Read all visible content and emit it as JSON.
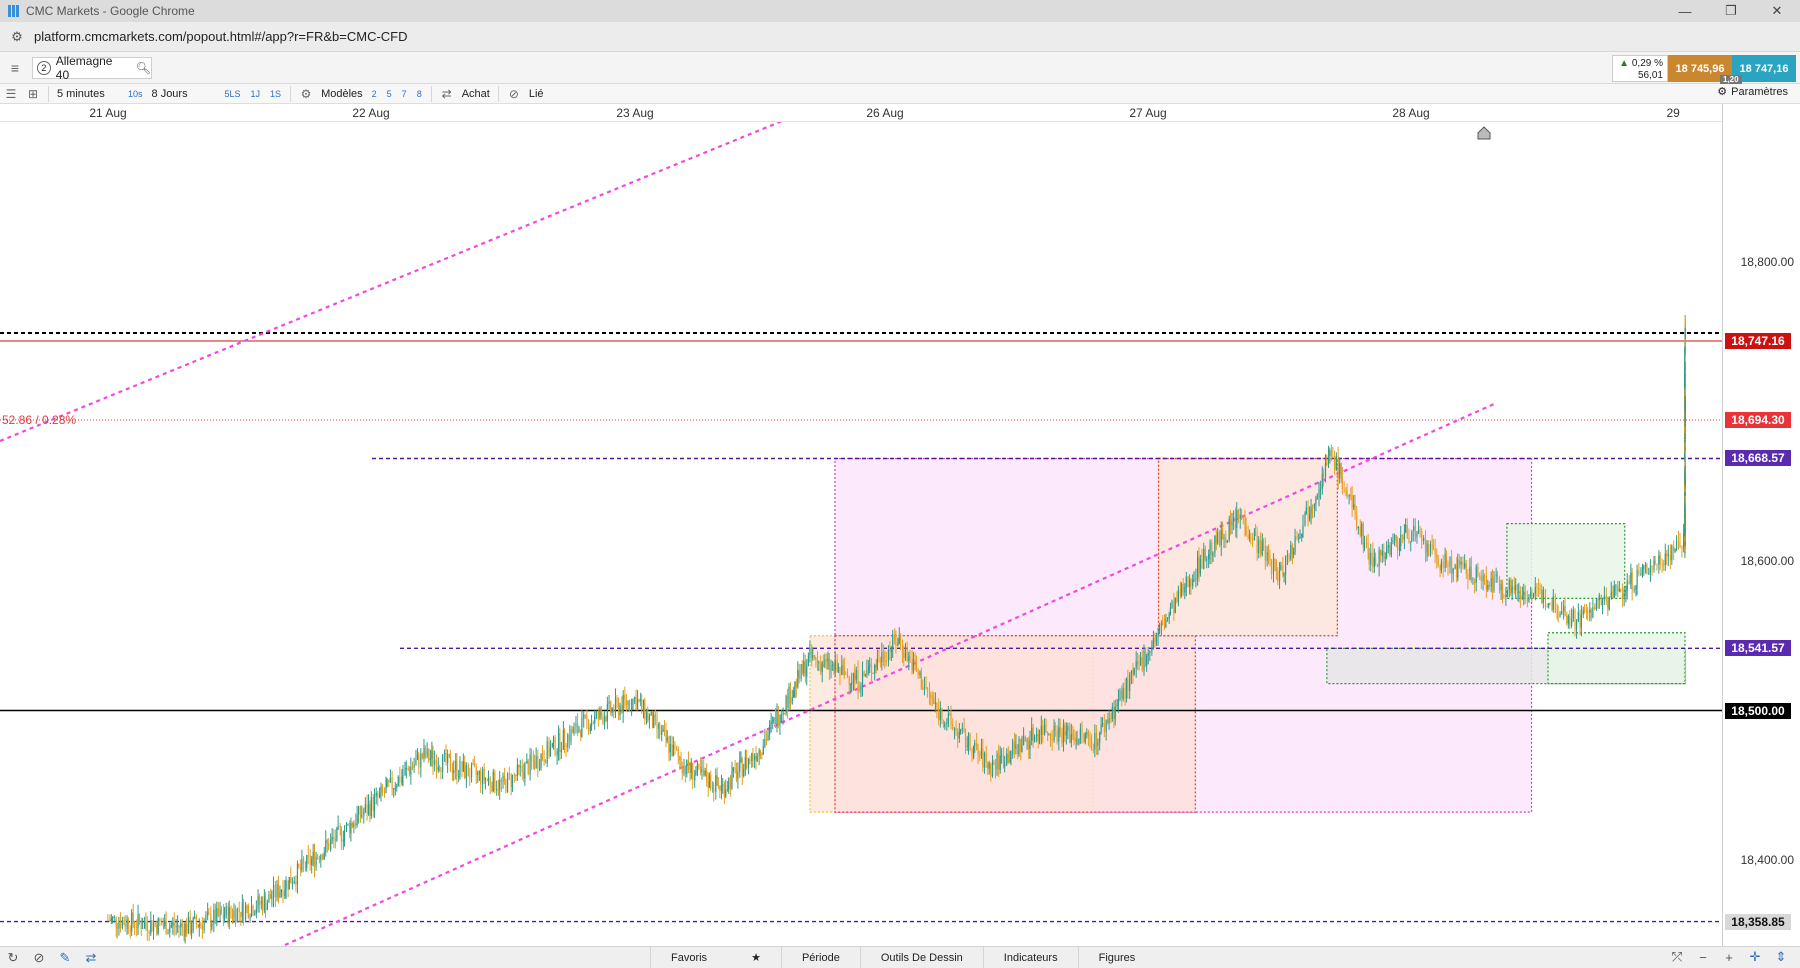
{
  "browser": {
    "window_title": "CMC Markets - Google Chrome",
    "url": "platform.cmcmarkets.com/popout.html#/app?r=FR&b=CMC-CFD",
    "win_buttons": [
      "—",
      "❐",
      "✕"
    ]
  },
  "instrument": {
    "number": "2",
    "name": "Allemagne 40",
    "change_pct": "0,29 %",
    "change_abs": "56,01",
    "sell_price": "18 745,96",
    "buy_price": "18 747,16",
    "spread": "1,20"
  },
  "toolbar": {
    "interval": "5 minutes",
    "interval_short": "10s",
    "range": "8 Jours",
    "range_buttons": [
      "5LS",
      "1J",
      "1S"
    ],
    "models_label": "Modèles",
    "model_buttons": [
      "2",
      "5",
      "7",
      "8"
    ],
    "buy_label": "Achat",
    "linked_label": "Lié",
    "settings_label": "Paramètres"
  },
  "date_axis": [
    "21 Aug",
    "22 Aug",
    "23 Aug",
    "26 Aug",
    "27 Aug",
    "28 Aug",
    "29 Aug"
  ],
  "price_axis": {
    "ticks": [
      "18,800.00",
      "18,600.00",
      "18,400.00"
    ],
    "tags": [
      {
        "label": "18,747.16",
        "value": 18747.16,
        "bg": "#cc1111",
        "fg": "#ffffff"
      },
      {
        "label": "18,694.30",
        "value": 18694.3,
        "bg": "#e8333a",
        "fg": "#ffffff"
      },
      {
        "label": "18,668.57",
        "value": 18668.57,
        "bg": "#5a2bb0",
        "fg": "#ffffff"
      },
      {
        "label": "18,541.57",
        "value": 18541.57,
        "bg": "#5a2bb0",
        "fg": "#ffffff"
      },
      {
        "label": "18,500.00",
        "value": 18500.0,
        "bg": "#000000",
        "fg": "#ffffff"
      },
      {
        "label": "18,358.85",
        "value": 18358.85,
        "bg": "#d8d8d8",
        "fg": "#111111"
      }
    ]
  },
  "chart_data": {
    "type": "candlestick",
    "instrument": "Allemagne 40",
    "interval": "5 minutes",
    "x_categories": [
      "21 Aug",
      "22 Aug",
      "23 Aug",
      "26 Aug",
      "27 Aug",
      "28 Aug",
      "29 Aug"
    ],
    "ylim": [
      18330,
      18900
    ],
    "y_ticks": [
      18400,
      18600,
      18800
    ],
    "horizontal_levels": [
      18747.16,
      18694.3,
      18668.57,
      18541.57,
      18500.0,
      18358.85
    ],
    "change_annotation": "52.86 / 0.28%",
    "price_path": [
      [
        0.0,
        18360
      ],
      [
        0.3,
        18355
      ],
      [
        0.6,
        18372
      ],
      [
        0.9,
        18420
      ],
      [
        1.2,
        18470
      ],
      [
        1.5,
        18450
      ],
      [
        1.8,
        18490
      ],
      [
        2.0,
        18508
      ],
      [
        2.2,
        18462
      ],
      [
        2.35,
        18448
      ],
      [
        2.5,
        18475
      ],
      [
        2.7,
        18535
      ],
      [
        2.9,
        18520
      ],
      [
        3.05,
        18548
      ],
      [
        3.2,
        18500
      ],
      [
        3.4,
        18462
      ],
      [
        3.6,
        18488
      ],
      [
        3.8,
        18480
      ],
      [
        4.0,
        18540
      ],
      [
        4.2,
        18600
      ],
      [
        4.35,
        18630
      ],
      [
        4.5,
        18590
      ],
      [
        4.7,
        18672
      ],
      [
        4.85,
        18600
      ],
      [
        5.0,
        18620
      ],
      [
        5.1,
        18600
      ],
      [
        5.3,
        18585
      ],
      [
        5.5,
        18575
      ],
      [
        5.6,
        18560
      ],
      [
        5.8,
        18585
      ],
      [
        6.0,
        18615
      ],
      [
        6.2,
        18630
      ],
      [
        6.4,
        18615
      ],
      [
        6.6,
        18625
      ],
      [
        6.8,
        18620
      ],
      [
        7.0,
        18640
      ],
      [
        7.2,
        18650
      ],
      [
        7.4,
        18640
      ],
      [
        7.6,
        18695
      ],
      [
        7.8,
        18710
      ],
      [
        8.0,
        18695
      ],
      [
        8.2,
        18700
      ],
      [
        8.4,
        18690
      ],
      [
        8.6,
        18685
      ],
      [
        8.8,
        18682
      ],
      [
        9.0,
        18690
      ],
      [
        9.2,
        18700
      ],
      [
        9.35,
        18720
      ],
      [
        9.45,
        18760
      ]
    ]
  },
  "bottom_tabs": [
    "Favoris",
    "Période",
    "Outils De Dessin",
    "Indicateurs",
    "Figures"
  ]
}
